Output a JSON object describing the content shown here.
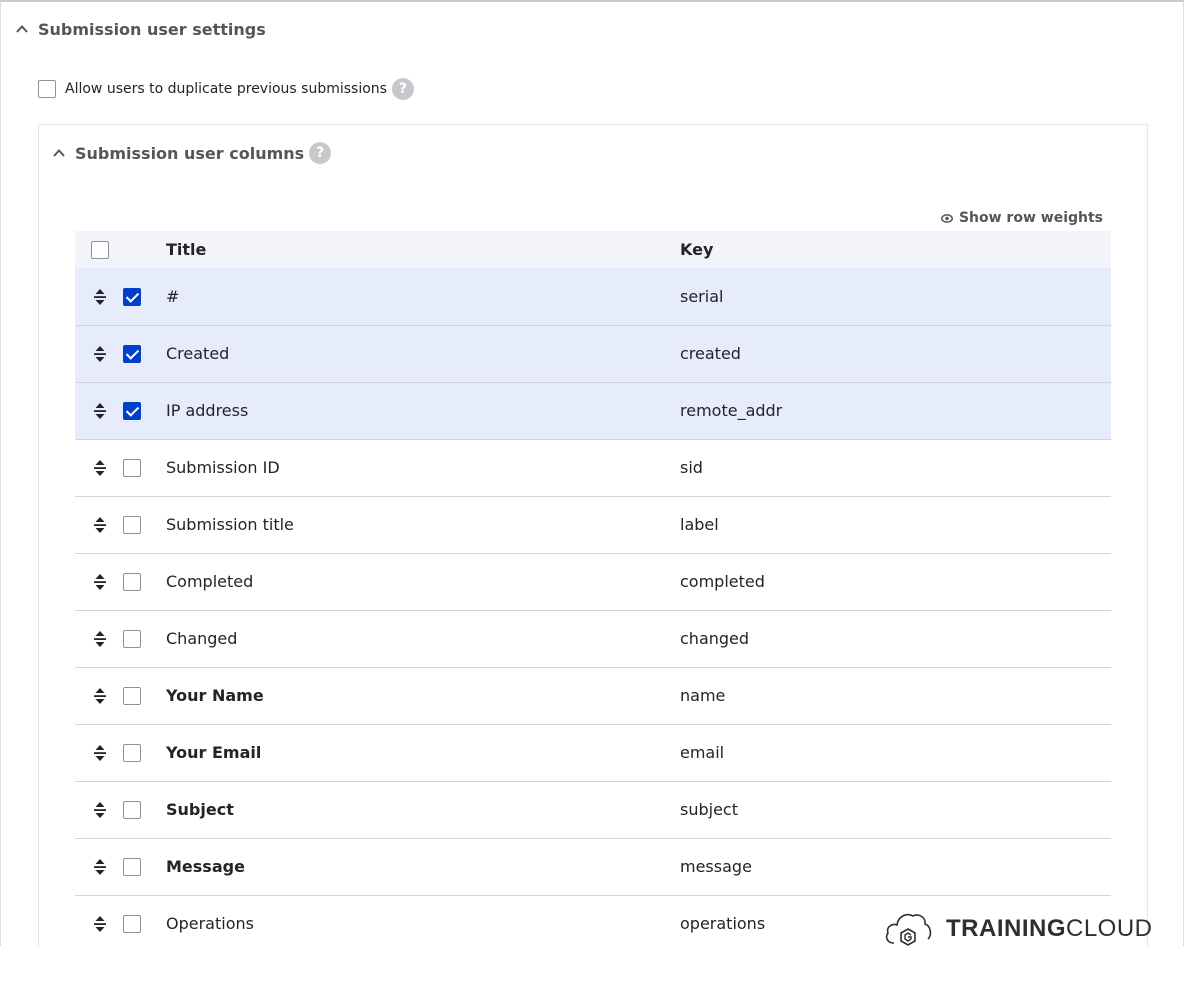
{
  "outer_section": {
    "title": "Submission user settings",
    "chevron_icon": "chevron-up-icon"
  },
  "duplicate_option": {
    "label": "Allow users to duplicate previous submissions",
    "checked": false,
    "help_glyph": "?"
  },
  "inner_section": {
    "title": "Submission user columns",
    "help_glyph": "?",
    "chevron_icon": "chevron-up-icon"
  },
  "show_row_weights": {
    "label": "Show row weights",
    "icon": "eye-icon"
  },
  "table": {
    "headers": {
      "title": "Title",
      "key": "Key"
    },
    "rows": [
      {
        "title": "#",
        "key": "serial",
        "checked": true,
        "bold": false
      },
      {
        "title": "Created",
        "key": "created",
        "checked": true,
        "bold": false
      },
      {
        "title": "IP address",
        "key": "remote_addr",
        "checked": true,
        "bold": false
      },
      {
        "title": "Submission ID",
        "key": "sid",
        "checked": false,
        "bold": false
      },
      {
        "title": "Submission title",
        "key": "label",
        "checked": false,
        "bold": false
      },
      {
        "title": "Completed",
        "key": "completed",
        "checked": false,
        "bold": false
      },
      {
        "title": "Changed",
        "key": "changed",
        "checked": false,
        "bold": false
      },
      {
        "title": "Your Name",
        "key": "name",
        "checked": false,
        "bold": true
      },
      {
        "title": "Your Email",
        "key": "email",
        "checked": false,
        "bold": true
      },
      {
        "title": "Subject",
        "key": "subject",
        "checked": false,
        "bold": true
      },
      {
        "title": "Message",
        "key": "message",
        "checked": false,
        "bold": true
      },
      {
        "title": "Operations",
        "key": "operations",
        "checked": false,
        "bold": false
      }
    ]
  },
  "watermark": {
    "part1": "TRAINING",
    "part2": "CLOUD",
    "icon": "cloud-logo-icon"
  },
  "colors": {
    "accent": "#003ecc",
    "selected_row": "#e6ecfc",
    "header_row": "#f3f4f9",
    "help_badge": "#c7c8cc"
  }
}
